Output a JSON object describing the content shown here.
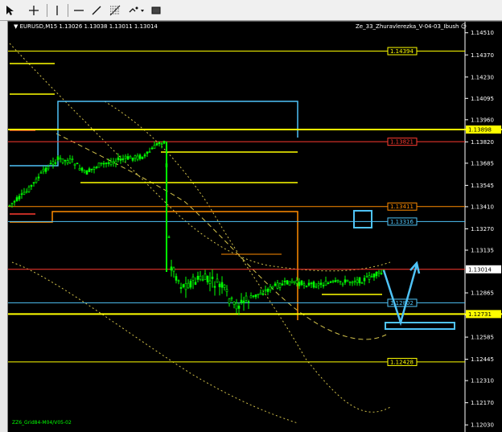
{
  "toolbar": {
    "buttons": [
      {
        "name": "cursor-button",
        "icon": "cursor-icon"
      },
      {
        "name": "crosshair-button",
        "icon": "crosshair-icon"
      },
      {
        "name": "vertical-line-button",
        "icon": "vertical-line-icon"
      },
      {
        "name": "horizontal-line-button",
        "icon": "horizontal-line-icon"
      },
      {
        "name": "trendline-button",
        "icon": "trendline-icon"
      },
      {
        "name": "fibonacci-button",
        "icon": "fibonacci-icon"
      },
      {
        "name": "shapes-button",
        "icon": "shapes-icon"
      },
      {
        "name": "rectangle-button",
        "icon": "rectangle-icon"
      }
    ]
  },
  "chart": {
    "symbol_line": "EURUSD,M15  1.13026 1.13038 1.13011 1.13014",
    "indicator_name": "Ze_33_Zhuravlerezka_V-04-03_Ibush",
    "bottom_label": "ZZ6_Grid84-M04/V05-02",
    "colors": {
      "background": "#000000",
      "yellow": "#ffff00",
      "cyan": "#4fc3f7",
      "orange": "#ff8c00",
      "red": "#ff3b30",
      "green": "#00ff00",
      "white": "#ffffff",
      "dashed": "#d2c14a"
    },
    "price_levels": [
      {
        "label": "1.14394",
        "price": 1.14394,
        "color": "#ffff00",
        "kind": "yellow"
      },
      {
        "label": "1.13821",
        "price": 1.13821,
        "color": "#ff3b30",
        "kind": "red"
      },
      {
        "label": "1.13411",
        "price": 1.13411,
        "color": "#ff8c00",
        "kind": "orange"
      },
      {
        "label": "1.13316",
        "price": 1.13316,
        "color": "#4fc3f7",
        "kind": "cyan"
      },
      {
        "label": "1.12802",
        "price": 1.12802,
        "color": "#4fc3f7",
        "kind": "cyan"
      },
      {
        "label": "1.12428",
        "price": 1.12428,
        "color": "#ffff00",
        "kind": "yellow"
      }
    ],
    "current_price": {
      "label": "1.13014",
      "price": 1.13014
    },
    "highlight_levels": [
      {
        "label": "1.13898",
        "price": 1.13898
      },
      {
        "label": "1.12731",
        "price": 1.12731
      }
    ],
    "axis": {
      "ticks": [
        "1.14510",
        "1.14370",
        "1.14230",
        "1.14095",
        "1.13960",
        "1.13820",
        "1.13685",
        "1.13545",
        "1.13410",
        "1.13270",
        "1.13135",
        "1.12865",
        "1.12725",
        "1.12585",
        "1.12445",
        "1.12310",
        "1.12170",
        "1.12030"
      ],
      "y_range": [
        1.11985,
        1.14585
      ]
    }
  }
}
